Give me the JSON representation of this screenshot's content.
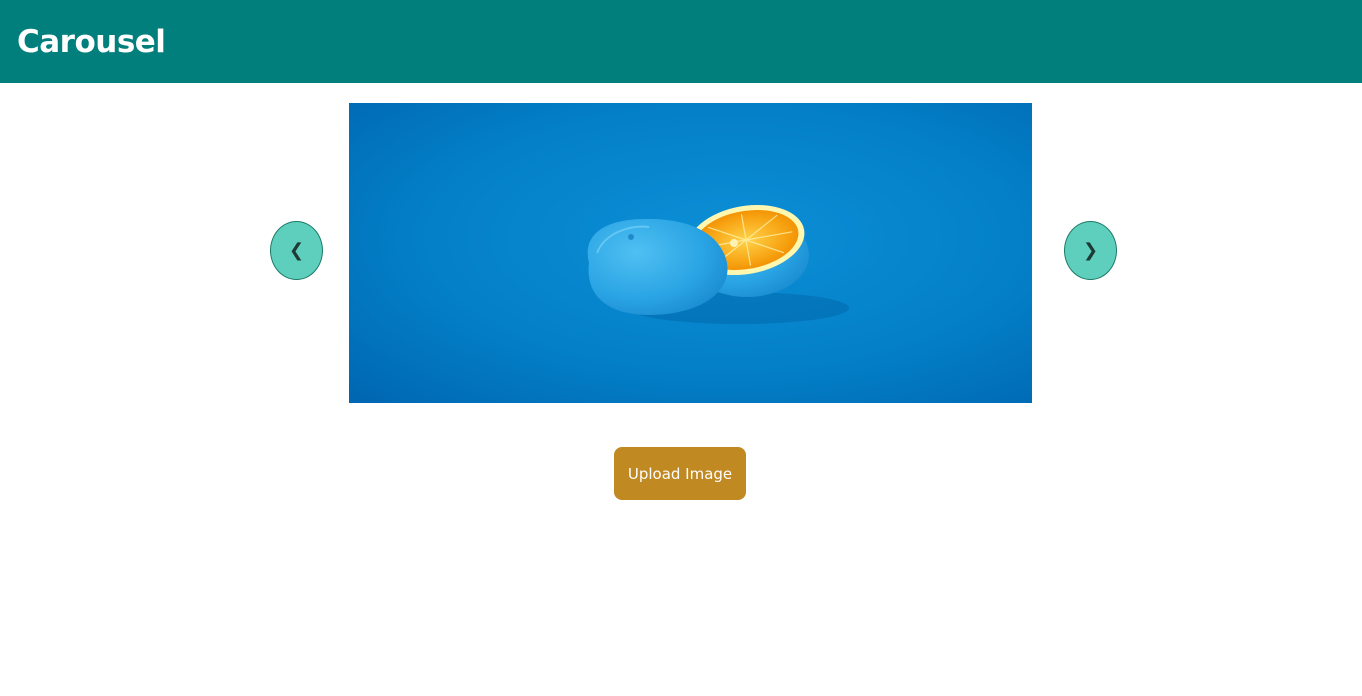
{
  "header": {
    "title": "Carousel",
    "background_color": "#007f7c"
  },
  "carousel": {
    "prev_glyph": "❮",
    "next_glyph": "❯",
    "prev_icon": "chevron-left-icon",
    "next_icon": "chevron-right-icon",
    "nav_button_color": "#5ecfbd"
  },
  "upload": {
    "label": "Upload Image",
    "color": "#c08921"
  }
}
